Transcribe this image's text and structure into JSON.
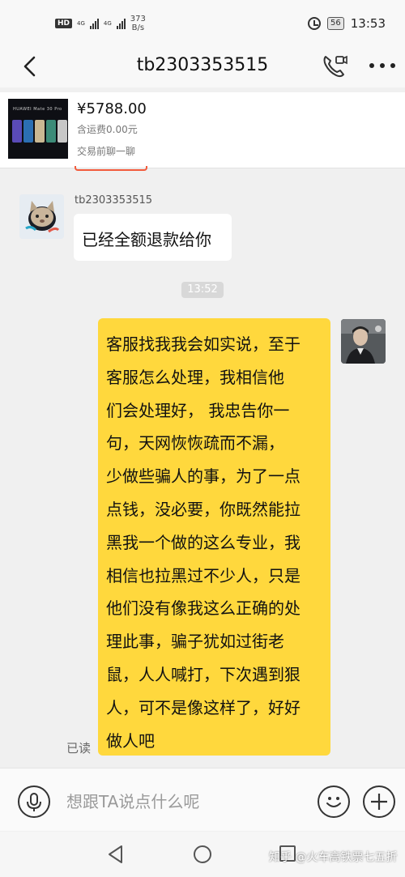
{
  "status_bar": {
    "hd": "HD",
    "network_tag_1": "4G",
    "network_tag_2": "4G",
    "speed_value": "373",
    "speed_unit": "B/s",
    "battery": "56",
    "time": "13:53"
  },
  "header": {
    "title": "tb2303353515"
  },
  "product": {
    "thumb_brand": "HUAWEI Mate 30 Pro",
    "price": "¥5788.00",
    "shipping": "含运费0.00元",
    "link": "交易前聊一聊"
  },
  "messages": {
    "sender_name": "tb2303353515",
    "incoming_text": "已经全额退款给你",
    "time_divider": "13:52",
    "outgoing_text": "客服找我我会如实说，至于\n客服怎么处理，我相信他\n们会处理好， 我忠告你一\n句，天网恢恢疏而不漏，\n少做些骗人的事，为了一点\n点钱，没必要，你既然能拉\n黑我一个做的这么专业，我\n相信也拉黑过不少人，只是\n他们没有像我这么正确的处\n理此事，骗子犹如过街老\n鼠，人人喊打，下次遇到狠\n人，可不是像这样了，好好\n做人吧",
    "read_status": "已读"
  },
  "input_bar": {
    "placeholder": "想跟TA说点什么呢"
  },
  "watermark": "知乎 @火车高铁票七五折",
  "colors": {
    "outgoing_bubble": "#ffd83d",
    "accent_orange": "#f25a3b"
  }
}
